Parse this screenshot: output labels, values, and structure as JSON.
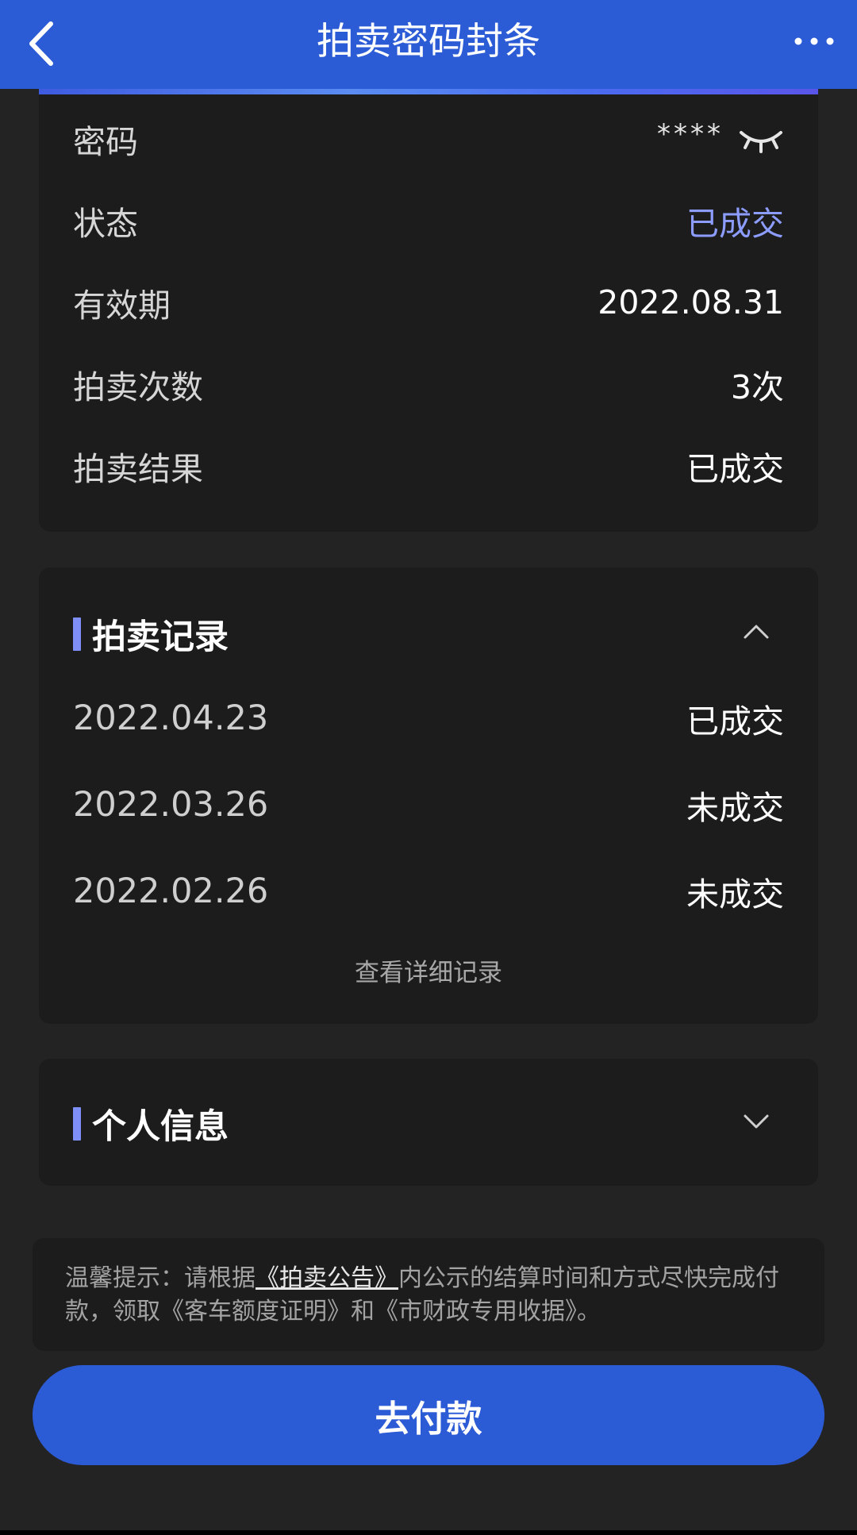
{
  "header": {
    "title": "拍卖密码封条",
    "back_icon": "chevron-left-icon",
    "more_icon": "more-dots-icon",
    "background_color": "#2c5bd6"
  },
  "info": {
    "password": {
      "label": "密码",
      "value": "****",
      "icon": "eye-closed-icon"
    },
    "status": {
      "label": "状态",
      "value": "已成交",
      "color": "#8d9dff"
    },
    "validity": {
      "label": "有效期",
      "value": "2022.08.31"
    },
    "count": {
      "label": "拍卖次数",
      "value": "3次"
    },
    "result": {
      "label": "拍卖结果",
      "value": "已成交"
    }
  },
  "records": {
    "title": "拍卖记录",
    "toggle_icon": "chevron-up-icon",
    "rows": [
      {
        "date": "2022.04.23",
        "status": "已成交"
      },
      {
        "date": "2022.03.26",
        "status": "未成交"
      },
      {
        "date": "2022.02.26",
        "status": "未成交"
      }
    ],
    "detail_link": "查看详细记录"
  },
  "personal": {
    "title": "个人信息",
    "toggle_icon": "chevron-down-icon"
  },
  "tip": {
    "prefix": "温馨提示：请根据",
    "link": "《拍卖公告》",
    "suffix": "内公示的结算时间和方式尽快完成付款，领取《客车额度证明》和《市财政专用收据》。"
  },
  "pay_button": {
    "label": "去付款",
    "color": "#2c5bd6"
  }
}
